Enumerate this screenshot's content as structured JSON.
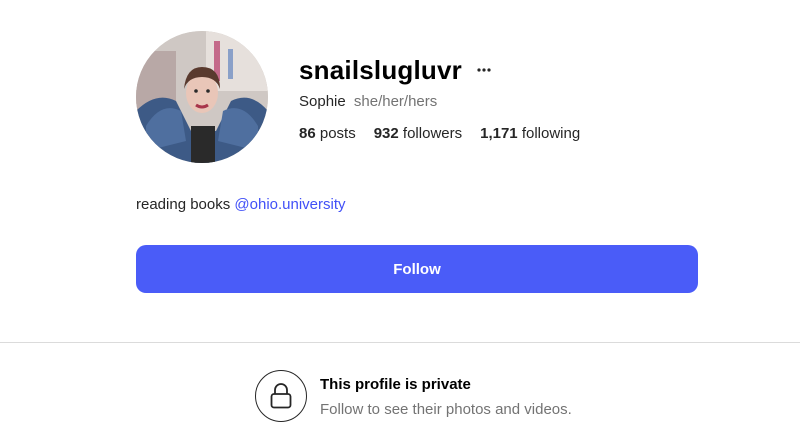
{
  "profile": {
    "username": "snailslugluvr",
    "full_name": "Sophie",
    "pronouns": "she/her/hers",
    "stats": {
      "posts_count": "86",
      "posts_label": "posts",
      "followers_count": "932",
      "followers_label": "followers",
      "following_count": "1,171",
      "following_label": "following"
    },
    "bio_text": "reading books",
    "bio_link": "@ohio.university"
  },
  "actions": {
    "follow_label": "Follow"
  },
  "private_notice": {
    "title": "This profile is private",
    "subtitle": "Follow to see their photos and videos."
  },
  "icons": {
    "more": "more-options-icon",
    "lock": "lock-icon"
  },
  "colors": {
    "accent": "#4a5cf8",
    "link": "#4150f7",
    "muted_text": "#737373",
    "divider": "#dbdbdb"
  }
}
